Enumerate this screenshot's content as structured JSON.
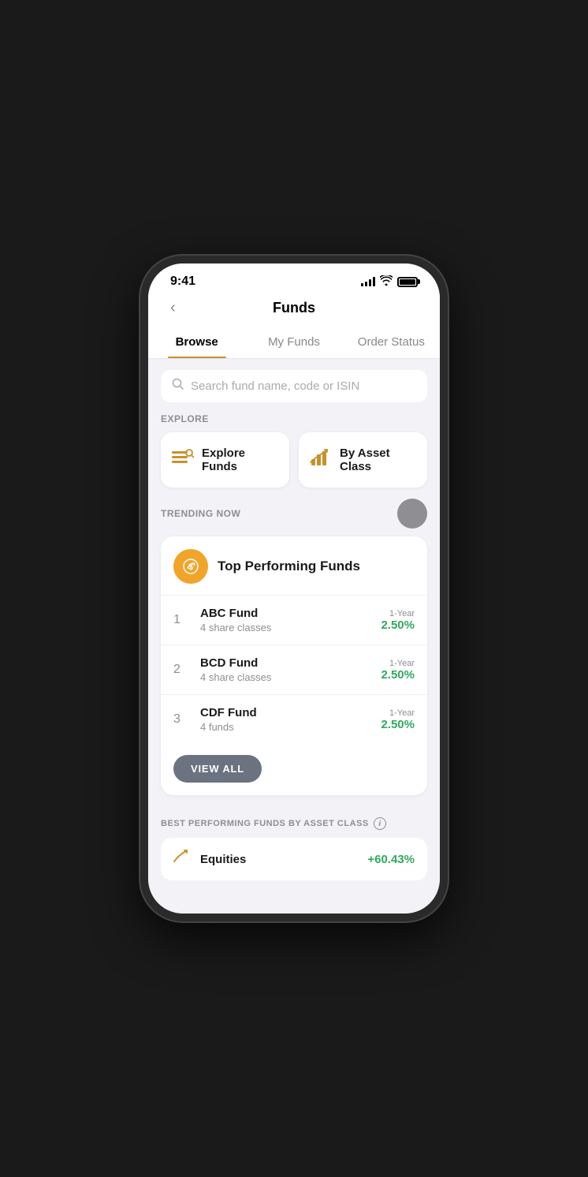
{
  "status_bar": {
    "time": "9:41",
    "signal_bars": [
      3,
      6,
      9,
      12
    ],
    "wifi": "wifi",
    "battery": "battery"
  },
  "nav": {
    "back_label": "‹",
    "title": "Funds"
  },
  "tabs": [
    {
      "id": "browse",
      "label": "Browse",
      "active": true
    },
    {
      "id": "my-funds",
      "label": "My Funds",
      "active": false
    },
    {
      "id": "order-status",
      "label": "Order Status",
      "active": false
    }
  ],
  "search": {
    "placeholder": "Search fund name, code or ISIN"
  },
  "explore": {
    "section_label": "EXPLORE",
    "cards": [
      {
        "id": "explore-funds",
        "label": "Explore Funds",
        "icon": "≡🔍"
      },
      {
        "id": "by-asset-class",
        "label": "By Asset Class",
        "icon": "📊"
      }
    ]
  },
  "trending": {
    "section_label": "TRENDING NOW",
    "card_title": "Top Performing Funds",
    "funds": [
      {
        "rank": "1",
        "name": "ABC Fund",
        "sub": "4 share classes",
        "period": "1-Year",
        "return_val": "2.50%"
      },
      {
        "rank": "2",
        "name": "BCD Fund",
        "sub": "4 share classes",
        "period": "1-Year",
        "return_val": "2.50%"
      },
      {
        "rank": "3",
        "name": "CDF Fund",
        "sub": "4 funds",
        "period": "1-Year",
        "return_val": "2.50%"
      }
    ],
    "view_all_label": "VIEW ALL"
  },
  "best_performing": {
    "section_label": "BEST PERFORMING FUNDS BY ASSET CLASS",
    "info": "i",
    "equities": {
      "label": "Equities",
      "return_val": "+60.43%"
    }
  },
  "colors": {
    "accent": "#c8912a",
    "green": "#2eaa5e",
    "tab_active_underline": "#c8912a",
    "gray": "#8e8e93"
  }
}
